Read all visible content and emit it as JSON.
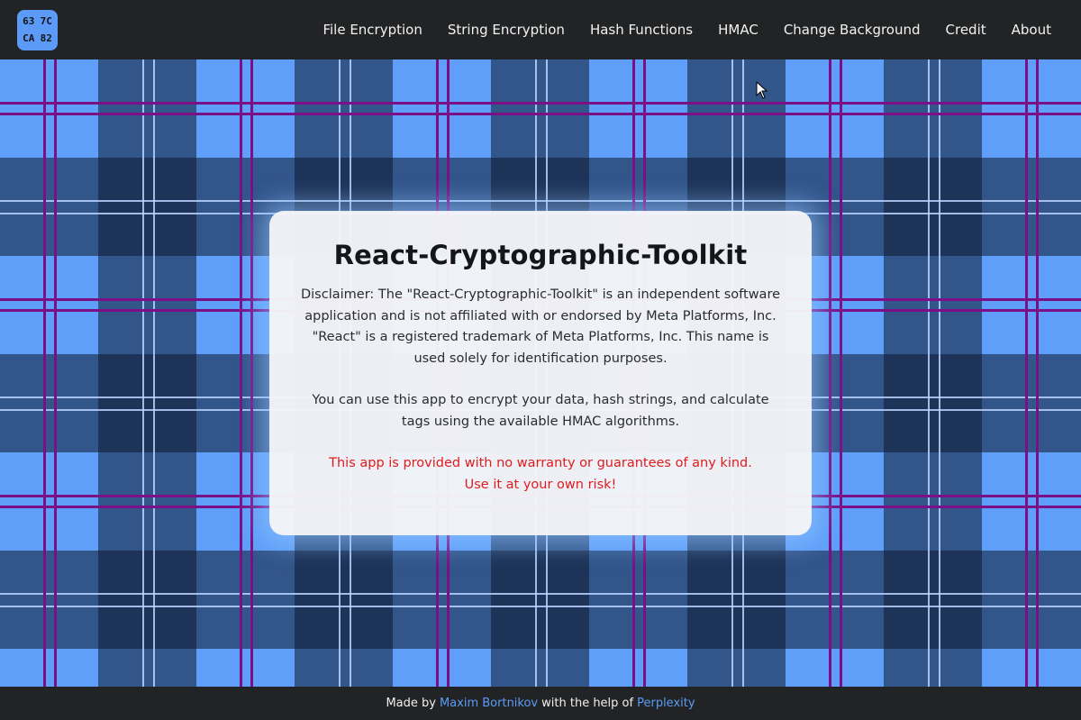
{
  "logo": {
    "line1": [
      "63",
      "7C"
    ],
    "line2": [
      "CA",
      "82"
    ]
  },
  "nav": {
    "items": [
      "File Encryption",
      "String Encryption",
      "Hash Functions",
      "HMAC",
      "Change Background",
      "Credit",
      "About"
    ]
  },
  "card": {
    "title": "React-Cryptographic-Toolkit",
    "disclaimer": "Disclaimer: The \"React-Cryptographic-Toolkit\" is an independent software application and is not affiliated with or endorsed by Meta Platforms, Inc. \"React\" is a registered trademark of Meta Platforms, Inc. This name is used solely for identification purposes.",
    "usage": "You can use this app to encrypt your data, hash strings, and calculate tags using the available HMAC algorithms.",
    "warning_line1": "This app is provided with no warranty or guarantees of any kind.",
    "warning_line2": "Use it at your own risk!"
  },
  "footer": {
    "prefix": "Made by",
    "author": "Maxim Bortnikov",
    "middle": "with the help of",
    "helper": "Perplexity"
  },
  "colors": {
    "background_light": "#5f9ff9",
    "background_mid": "#335280",
    "background_dark": "#192740",
    "stripe_purple": "#7a0f86",
    "stripe_light": "#b8d4ff",
    "accent": "#5b9bf7",
    "warning": "#e01c1c"
  }
}
